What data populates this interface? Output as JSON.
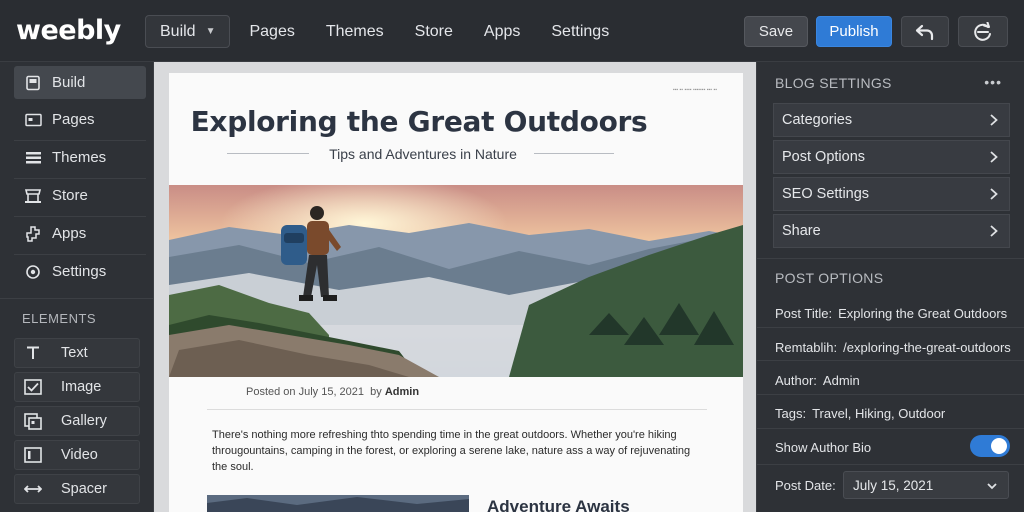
{
  "brand": {
    "logo": "weebly",
    "accent": "#2f7bd6"
  },
  "topnav": {
    "build": "Build",
    "items": [
      "Pages",
      "Themes",
      "Store",
      "Apps",
      "Settings"
    ]
  },
  "toolbar": {
    "save": "Save",
    "publish": "Publish"
  },
  "sidebar": {
    "items": [
      {
        "label": "Build",
        "icon": "build-icon"
      },
      {
        "label": "Pages",
        "icon": "pages-icon"
      },
      {
        "label": "Themes",
        "icon": "themes-icon"
      },
      {
        "label": "Store",
        "icon": "store-icon"
      },
      {
        "label": "Apps",
        "icon": "apps-icon"
      },
      {
        "label": "Settings",
        "icon": "settings-icon"
      }
    ],
    "elements_heading": "ELEMENTS",
    "elements": [
      {
        "label": "Text",
        "icon": "text-icon"
      },
      {
        "label": "Image",
        "icon": "image-icon"
      },
      {
        "label": "Gallery",
        "icon": "gallery-icon"
      },
      {
        "label": "Video",
        "icon": "video-icon"
      },
      {
        "label": "Spacer",
        "icon": "spacer-icon"
      }
    ]
  },
  "page": {
    "title": "Exploring the Great Outdoors",
    "subtitle": "Tips and Adventures in Nature",
    "posted_prefix": "Posted on July 15, 2021",
    "posted_by": "by",
    "author": "Admin",
    "body": "There's nothing more refreshing thto spending time in the great outdoors. Whether you're hiking througountains, camping in the forest, or exploring a serene lake, nature ass a way of rejuvenating the soul.",
    "aside_title": "Adventure Awaits"
  },
  "blog_settings": {
    "heading": "BLOG SETTINGS",
    "items": [
      "Categories",
      "Post Options",
      "SEO Settings",
      "Share"
    ]
  },
  "post_options": {
    "heading": "POST OPTIONS",
    "post_title_label": "Post Title:",
    "post_title_value": "Exploring the Great Outdoors",
    "permalink_label": "Remtablih:",
    "permalink_value": "/exploring-the-great-outdoors",
    "author_label": "Author:",
    "author_value": "Admin",
    "tags_label": "Tags:",
    "tags_value": "Travel, Hiking, Outdoor",
    "show_author_bio_label": "Show Author Bio",
    "show_author_bio": true,
    "post_date_label": "Post Date:",
    "post_date_value": "July 15, 2021"
  }
}
